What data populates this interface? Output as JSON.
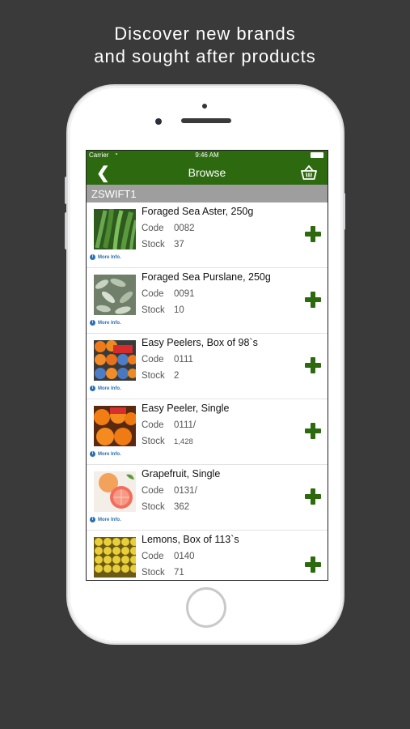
{
  "headline": {
    "line1": "Discover new brands",
    "line2": "and sought after products"
  },
  "status_bar": {
    "carrier": "Carrier",
    "time": "9:46 AM"
  },
  "nav": {
    "title": "Browse"
  },
  "section_header": "ZSWIFT1",
  "labels": {
    "code": "Code",
    "stock": "Stock",
    "more_info": "More Info."
  },
  "products": [
    {
      "name": "Foraged Sea Aster, 250g",
      "code": "0082",
      "stock": "37",
      "thumb": "green-leaves"
    },
    {
      "name": "Foraged Sea Purslane, 250g",
      "code": "0091",
      "stock": "10",
      "thumb": "silver-leaves"
    },
    {
      "name": "Easy Peelers, Box of 98`s",
      "code": "0111",
      "stock": "2",
      "thumb": "orange-box"
    },
    {
      "name": "Easy Peeler, Single",
      "code": "0111/",
      "stock": "1,428",
      "thumb": "oranges"
    },
    {
      "name": "Grapefruit, Single",
      "code": "0131/",
      "stock": "362",
      "thumb": "grapefruit"
    },
    {
      "name": "Lemons, Box of 113`s",
      "code": "0140",
      "stock": "71",
      "thumb": "lemons"
    }
  ],
  "colors": {
    "brand_green": "#2d6a0f",
    "section_grey": "#9e9e9e",
    "background": "#3a3a3b",
    "link_blue": "#2a6fb3"
  }
}
